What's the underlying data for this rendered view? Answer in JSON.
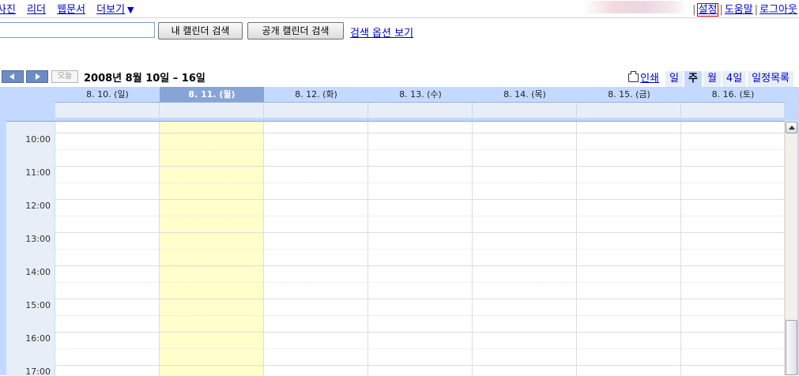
{
  "topbar": {
    "nav": [
      "사진",
      "리더",
      "웹문서",
      "더보기"
    ],
    "more_arrow": "▼",
    "settings": "설정",
    "help": "도움말",
    "logout": "로그아웃",
    "separator": "|"
  },
  "search": {
    "value": "",
    "my_calendar_btn": "내 캘린더 검색",
    "public_calendar_btn": "공개 캘린더 검색",
    "options_link": "검색 옵션 보기"
  },
  "toolbar": {
    "today": "오늘",
    "date_range": "2008년 8월 10일 – 16일",
    "print": "인쇄",
    "views": [
      {
        "label": "일",
        "active": false
      },
      {
        "label": "주",
        "active": true
      },
      {
        "label": "월",
        "active": false
      },
      {
        "label": "4일",
        "active": false
      },
      {
        "label": "일정목록",
        "active": false
      }
    ]
  },
  "calendar": {
    "days": [
      {
        "label": "8. 10. (일)",
        "today": false
      },
      {
        "label": "8. 11. (월)",
        "today": true
      },
      {
        "label": "8. 12. (화)",
        "today": false
      },
      {
        "label": "8. 13. (수)",
        "today": false
      },
      {
        "label": "8. 14. (목)",
        "today": false
      },
      {
        "label": "8. 15. (금)",
        "today": false
      },
      {
        "label": "8. 16. (토)",
        "today": false
      }
    ],
    "hours": [
      "10:00",
      "11:00",
      "12:00",
      "13:00",
      "14:00",
      "15:00",
      "16:00",
      "17:00"
    ],
    "today_color": "#ffffcc",
    "header_color": "#c3d9ff"
  }
}
